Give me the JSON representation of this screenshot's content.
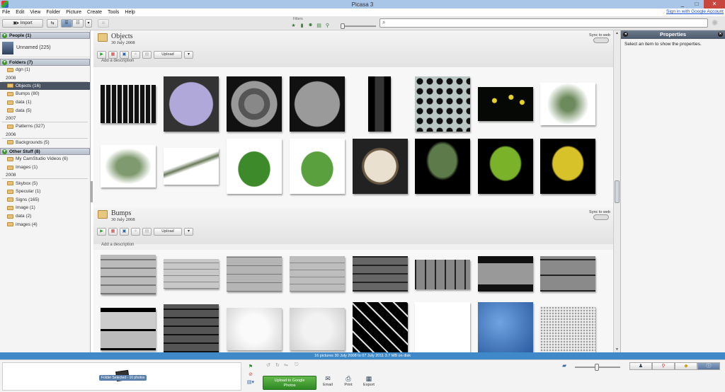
{
  "window": {
    "title": "Picasa 3",
    "minimize": "_",
    "maximize": "□",
    "close": "✕"
  },
  "menu": {
    "items": [
      "File",
      "Edit",
      "View",
      "Folder",
      "Picture",
      "Create",
      "Tools",
      "Help"
    ],
    "signin": "Sign in with Google Account"
  },
  "toolbar": {
    "import_label": "Import",
    "filters_label": "Filters",
    "search_placeholder": ""
  },
  "sidebar": {
    "people_header": "People (1)",
    "person_label": "Unnamed (225)",
    "folders_header": "Folders (7)",
    "folder_group_a": [
      {
        "label": "dgn (1)"
      }
    ],
    "year_2008a": "2008",
    "folder_group_b": [
      {
        "label": "Objects (16)"
      },
      {
        "label": "Bumps (80)"
      },
      {
        "label": "data (1)"
      },
      {
        "label": "data (5)"
      }
    ],
    "year_2007": "2007",
    "folder_group_c": [
      {
        "label": "Patterns (327)"
      }
    ],
    "year_2006": "2006",
    "folder_group_d": [
      {
        "label": "Backgrounds (5)"
      }
    ],
    "other_header": "Other Stuff (8)",
    "folder_group_e": [
      {
        "label": "My CamStudio Videos (6)"
      },
      {
        "label": "Images (1)"
      }
    ],
    "year_2008b": "2008",
    "folder_group_f": [
      {
        "label": "Skybox (5)"
      },
      {
        "label": "Specular (1)"
      },
      {
        "label": "Signs (165)"
      },
      {
        "label": "Image (1)"
      },
      {
        "label": "data (2)"
      },
      {
        "label": "images (4)"
      }
    ]
  },
  "albums": [
    {
      "name": "Objects",
      "date": "30 July 2008",
      "sync_label": "Sync to web",
      "upload_label": "Upload",
      "description": "Add a description"
    },
    {
      "name": "Bumps",
      "date": "30 July 2008",
      "sync_label": "Sync to web",
      "upload_label": "Upload",
      "description": "Add a description"
    }
  ],
  "properties": {
    "title": "Properties",
    "message": "Select an item to show the properties."
  },
  "status": {
    "text": "16 pictures    30 July 2008 to 07 July 2011    3.7 MB on disk"
  },
  "tray": {
    "folder_selected": "Folder Selected - 16 photos",
    "upload_line1": "Upload to Google",
    "upload_line2": "Photos",
    "email_label": "Email",
    "print_label": "Print",
    "export_label": "Export"
  }
}
